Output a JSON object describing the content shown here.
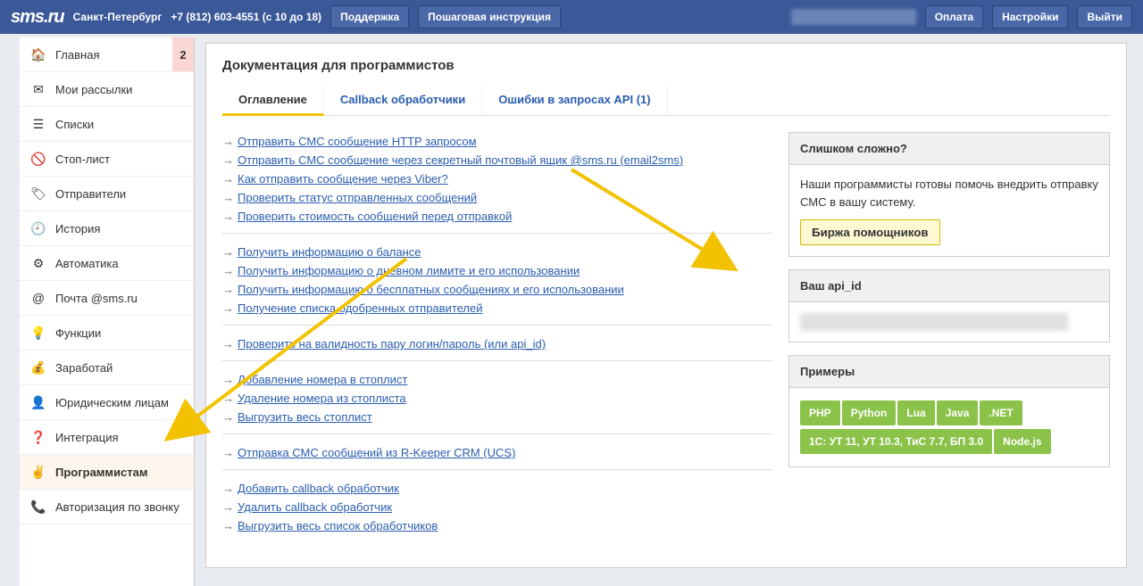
{
  "topbar": {
    "logo_text": "sms.ru",
    "city": "Санкт-Петербург",
    "phone": "+7 (812) 603-4551 (с 10 до 18)",
    "support": "Поддержка",
    "guide": "Пошаговая инструкция",
    "payment": "Оплата",
    "settings": "Настройки",
    "logout": "Выйти"
  },
  "sidebar": {
    "items": [
      {
        "icon": "🏠",
        "label": "Главная",
        "badge": "2"
      },
      {
        "icon": "✉",
        "label": "Мои рассылки"
      },
      {
        "icon": "☰",
        "label": "Списки"
      },
      {
        "icon": "🚫",
        "label": "Стоп-лист"
      },
      {
        "icon": "🏷",
        "label": "Отправители"
      },
      {
        "icon": "🕘",
        "label": "История"
      },
      {
        "icon": "⚙",
        "label": "Автоматика"
      },
      {
        "icon": "@",
        "label": "Почта @sms.ru"
      },
      {
        "icon": "💡",
        "label": "Функции"
      },
      {
        "icon": "💰",
        "label": "Заработай"
      },
      {
        "icon": "👤",
        "label": "Юридическим лицам"
      },
      {
        "icon": "❓",
        "label": "Интеграция"
      },
      {
        "icon": "✌",
        "label": "Программистам",
        "active": true
      },
      {
        "icon": "📞",
        "label": "Авторизация по звонку"
      }
    ]
  },
  "page": {
    "title": "Документация для программистов",
    "tabs": [
      {
        "label": "Оглавление",
        "active": true
      },
      {
        "label": "Callback обработчики"
      },
      {
        "label": "Ошибки в запросах API (1)"
      }
    ],
    "link_groups": [
      [
        "Отправить СМС сообщение HTTP запросом",
        "Отправить СМС сообщение через секретный почтовый ящик @sms.ru (email2sms)",
        "Как отправить сообщение через Viber?",
        "Проверить статус отправленных сообщений",
        "Проверить стоимость сообщений перед отправкой"
      ],
      [
        "Получить информацию о балансе",
        "Получить информацию о дневном лимите и его использовании",
        "Получить информацию о бесплатных сообщениях и его использовании",
        "Получение списка одобренных отправителей"
      ],
      [
        "Проверить на валидность пару логин/пароль (или api_id)"
      ],
      [
        "Добавление номера в стоплист",
        "Удаление номера из стоплиста",
        "Выгрузить весь стоплист"
      ],
      [
        "Отправка СМС сообщений из R-Keeper CRM (UCS)"
      ],
      [
        "Добавить callback обработчик",
        "Удалить callback обработчик",
        "Выгрузить весь список обработчиков"
      ]
    ]
  },
  "side": {
    "help_title": "Слишком сложно?",
    "help_text": "Наши программисты готовы помочь внедрить отправку СМС в вашу систему.",
    "help_btn": "Биржа помощников",
    "api_title": "Ваш api_id",
    "examples_title": "Примеры",
    "examples": [
      "PHP",
      "Python",
      "Lua",
      "Java",
      ".NET",
      "1С: УТ 11, УТ 10.3, ТиС 7.7, БП 3.0",
      "Node.js"
    ]
  }
}
